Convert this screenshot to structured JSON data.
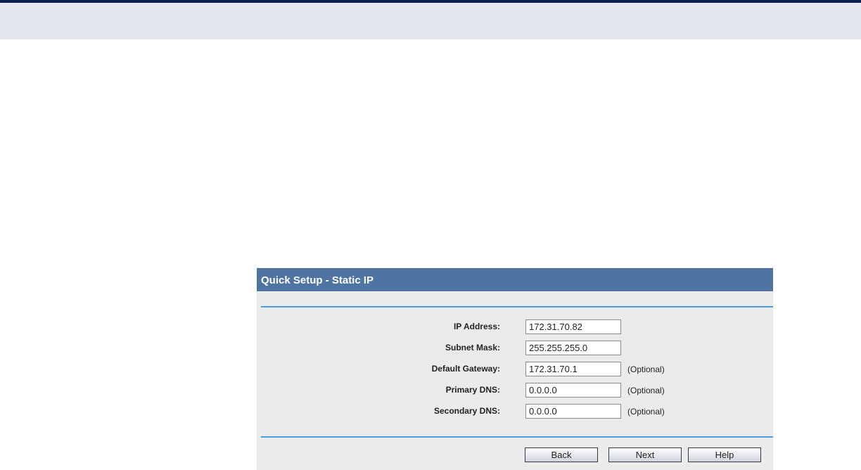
{
  "panel": {
    "title": "Quick Setup - Static IP"
  },
  "fields": [
    {
      "label": "IP Address:",
      "value": "172.31.70.82",
      "note": ""
    },
    {
      "label": "Subnet Mask:",
      "value": "255.255.255.0",
      "note": ""
    },
    {
      "label": "Default Gateway:",
      "value": "172.31.70.1",
      "note": "(Optional)"
    },
    {
      "label": "Primary DNS:",
      "value": "0.0.0.0",
      "note": "(Optional)"
    },
    {
      "label": "Secondary DNS:",
      "value": "0.0.0.0",
      "note": "(Optional)"
    }
  ],
  "buttons": {
    "back": "Back",
    "next": "Next",
    "help": "Help"
  },
  "colors": {
    "header_bar": "#0a1f4e",
    "banner": "#e4e7ef",
    "panel_header": "#4f74a2",
    "divider": "#4a9be0",
    "panel_background": "#ebebeb"
  }
}
